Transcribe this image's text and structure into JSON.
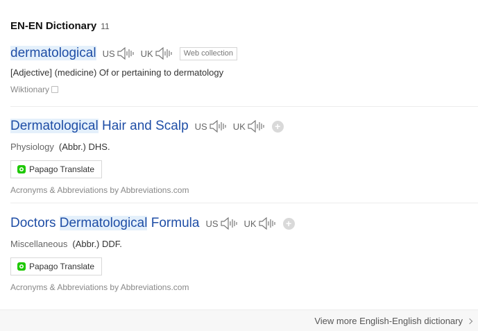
{
  "header": {
    "title": "EN-EN Dictionary",
    "count": "11"
  },
  "pron": {
    "us": "US",
    "uk": "UK"
  },
  "entries": [
    {
      "word_parts": [
        "dermatological"
      ],
      "tag": "Web collection",
      "definition": "[Adjective] (medicine) Of or pertaining to dermatology",
      "source": "Wiktionary"
    },
    {
      "word_parts": [
        "Dermatological",
        " Hair and Scalp"
      ],
      "category": "Physiology",
      "abbr": "(Abbr.) DHS.",
      "translate": "Papago Translate",
      "source": "Acronyms & Abbreviations by Abbreviations.com"
    },
    {
      "word_parts": [
        "Doctors ",
        "Dermatological",
        " Formula"
      ],
      "category": "Miscellaneous",
      "abbr": "(Abbr.) DDF.",
      "translate": "Papago Translate",
      "source": "Acronyms & Abbreviations by Abbreviations.com"
    }
  ],
  "add_symbol": "+",
  "footer": {
    "more_label": "View more English-English dictionary"
  },
  "icons": {
    "speaker": "speaker-icon",
    "copy": "copy-icon",
    "papago": "papago-icon",
    "add": "plus-icon",
    "chevron": "chevron-right-icon"
  },
  "colors": {
    "link": "#1f4ea6",
    "highlight": "#e4f0fb",
    "papago": "#1ec800"
  }
}
